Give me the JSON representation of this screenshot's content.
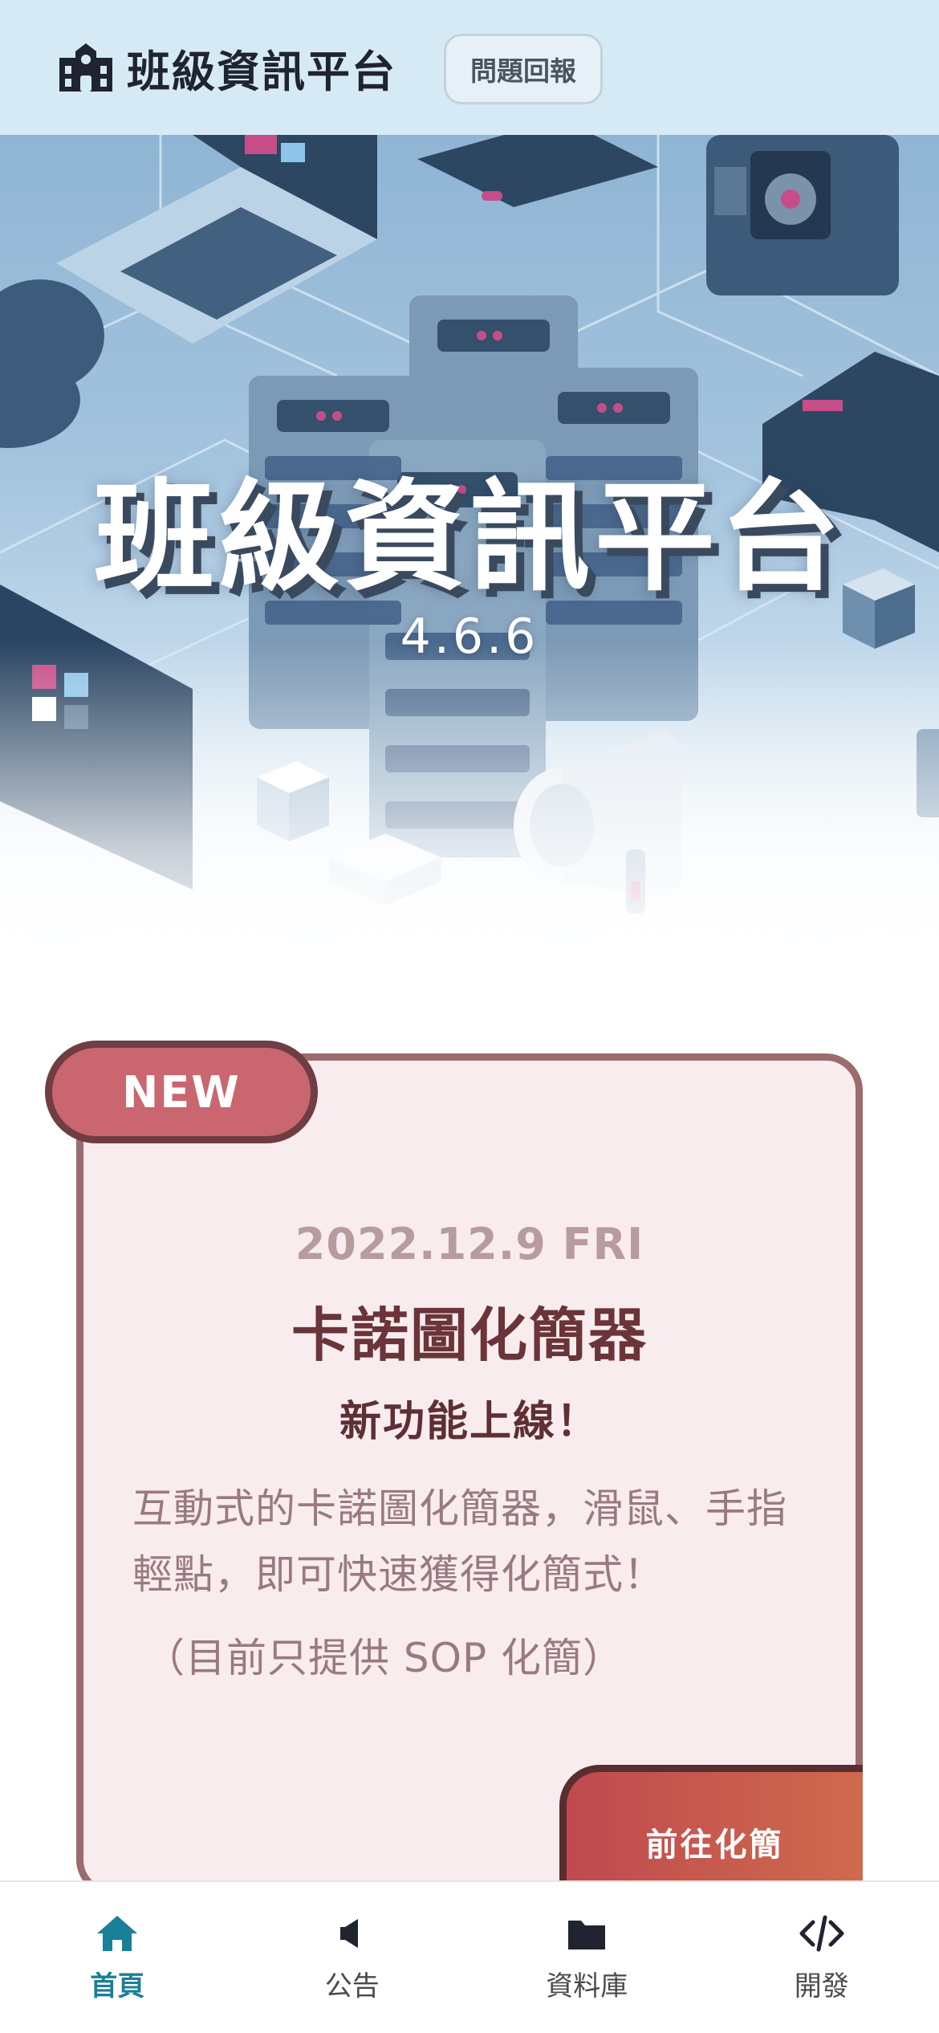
{
  "header": {
    "brand_icon": "school-icon",
    "title": "班級資訊平台",
    "report_button": "問題回報"
  },
  "hero": {
    "title": "班級資訊平台",
    "version": "4.6.6"
  },
  "news_card": {
    "badge": "NEW",
    "date": "2022.12.9 FRI",
    "title": "卡諾圖化簡器",
    "subtitle": "新功能上線！",
    "description": "互動式的卡諾圖化簡器，滑鼠、手指輕點，即可快速獲得化簡式！",
    "note": "（目前只提供 SOP 化簡）",
    "button": "前往化簡"
  },
  "bottom_nav": {
    "active_color": "#1a7f99",
    "items": [
      {
        "label": "首頁",
        "icon": "home-icon"
      },
      {
        "label": "公告",
        "icon": "megaphone-icon"
      },
      {
        "label": "資料庫",
        "icon": "folder-icon"
      },
      {
        "label": "開發",
        "icon": "code-icon"
      }
    ]
  },
  "colors": {
    "header_bg": "#d6eaf5",
    "card_bg": "#f8ecef",
    "card_border": "#9b6b6e",
    "badge_bg": "#c9666f"
  }
}
